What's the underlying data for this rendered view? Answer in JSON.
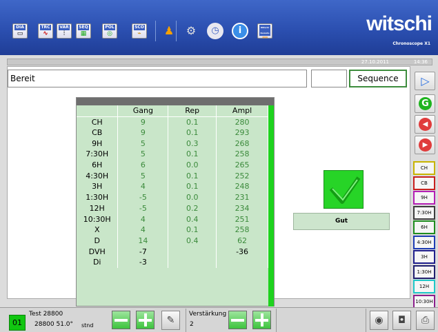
{
  "app": {
    "brand": "witschi",
    "brand_sub": "Chronoscope X1",
    "date": "27.10.2011",
    "time": "14:36"
  },
  "toolbar": {
    "buttons": [
      {
        "label": "DIA",
        "icon": "dia-icon"
      },
      {
        "label": "TRC",
        "icon": "trc-icon"
      },
      {
        "label": "VAR",
        "icon": "var-icon"
      },
      {
        "label": "SEQ",
        "icon": "seq-icon"
      },
      {
        "label": "POL",
        "icon": "pol-icon"
      },
      {
        "label": "SCO",
        "icon": "sco-icon"
      },
      {
        "label": "",
        "icon": "users-icon"
      },
      {
        "label": "",
        "icon": "gear-icon"
      },
      {
        "label": "",
        "icon": "clock-icon"
      },
      {
        "label": "",
        "icon": "info-icon"
      },
      {
        "label": "Witschi Remote",
        "icon": "remote-icon"
      }
    ]
  },
  "status": {
    "text": "Bereit",
    "sequence_label": "Sequence"
  },
  "table": {
    "columns": [
      "Gang",
      "Rep",
      "Ampl"
    ],
    "rows": [
      {
        "label": "CH",
        "gang": "9",
        "rep": "0.1",
        "ampl": "280"
      },
      {
        "label": "CB",
        "gang": "9",
        "rep": "0.1",
        "ampl": "293"
      },
      {
        "label": "9H",
        "gang": "5",
        "rep": "0.3",
        "ampl": "268"
      },
      {
        "label": "7:30H",
        "gang": "5",
        "rep": "0.1",
        "ampl": "258"
      },
      {
        "label": "6H",
        "gang": "6",
        "rep": "0.0",
        "ampl": "265"
      },
      {
        "label": "4:30H",
        "gang": "5",
        "rep": "0.1",
        "ampl": "252"
      },
      {
        "label": "3H",
        "gang": "4",
        "rep": "0.1",
        "ampl": "248"
      },
      {
        "label": "1:30H",
        "gang": "-5",
        "rep": "0.0",
        "ampl": "231"
      },
      {
        "label": "12H",
        "gang": "-5",
        "rep": "0.2",
        "ampl": "234"
      },
      {
        "label": "10:30H",
        "gang": "4",
        "rep": "0.4",
        "ampl": "251"
      },
      {
        "label": "X",
        "gang": "4",
        "rep": "0.1",
        "ampl": "258"
      },
      {
        "label": "D",
        "gang": "14",
        "rep": "0.4",
        "ampl": "62"
      },
      {
        "label": "DVH",
        "gang": "-7",
        "rep": "",
        "ampl": "-36"
      },
      {
        "label": "Di",
        "gang": "-3",
        "rep": "",
        "ampl": ""
      }
    ]
  },
  "result": {
    "label": "Gut",
    "color": "#27d427"
  },
  "sidebar": {
    "positions": [
      {
        "label": "CH",
        "color": "#c8b400"
      },
      {
        "label": "CB",
        "color": "#c81e1e"
      },
      {
        "label": "9H",
        "color": "#b41eb4"
      },
      {
        "label": "7:30H",
        "color": "#3c3c3c"
      },
      {
        "label": "6H",
        "color": "#1e8c1e"
      },
      {
        "label": "4:30H",
        "color": "#1e3cb4"
      },
      {
        "label": "3H",
        "color": "#1e1e8c"
      },
      {
        "label": "1:30H",
        "color": "#1e1e6e"
      },
      {
        "label": "12H",
        "color": "#1ec8c8"
      },
      {
        "label": "10:30H",
        "color": "#8c1e8c"
      }
    ]
  },
  "bottom": {
    "program_number": "01",
    "test_name": "Test 28800",
    "test_detail": "28800 51.0°",
    "mode": "stnd",
    "gain_label": "Verstärkung",
    "gain_value": "2"
  }
}
